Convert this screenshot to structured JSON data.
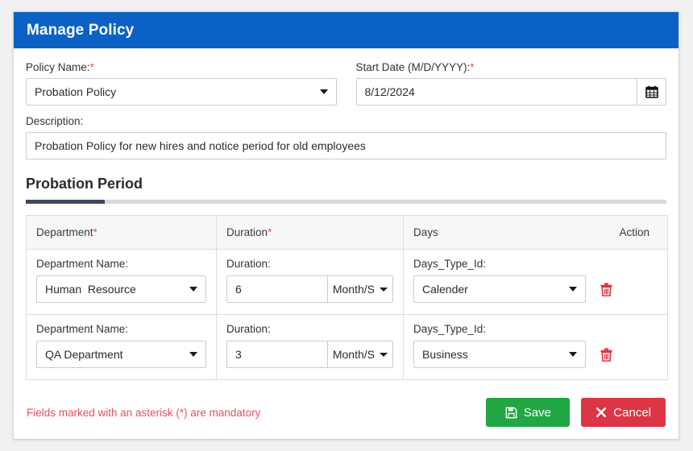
{
  "header": {
    "title": "Manage Policy",
    "bg_color": "#0b62c4"
  },
  "form": {
    "policy_name": {
      "label": "Policy Name:",
      "required_marker": "*",
      "value": "Probation Policy",
      "control": "select"
    },
    "start_date": {
      "label": "Start Date (M/D/YYYY):",
      "required_marker": "*",
      "value": "8/12/2024",
      "calendar_icon": "calendar-icon"
    },
    "description": {
      "label": "Description:",
      "value": "Probation Policy for new hires and notice period for old employees"
    }
  },
  "section": {
    "tab_label": "Probation Period",
    "active_underline_color": "#3d4a5c"
  },
  "table": {
    "columns": [
      {
        "label": "Department",
        "required_marker": "*"
      },
      {
        "label": "Duration",
        "required_marker": "*"
      },
      {
        "label": "Days",
        "required_marker": ""
      },
      {
        "label": "Action",
        "required_marker": ""
      }
    ],
    "field_labels": {
      "department": "Department Name:",
      "duration": "Duration:",
      "days_type": "Days_Type_Id:"
    },
    "rows": [
      {
        "department": "Human  Resource",
        "duration_value": "6",
        "duration_unit": "Month/S",
        "days_type": "Calender",
        "delete_icon": "trash-icon"
      },
      {
        "department": "QA Department",
        "duration_value": "3",
        "duration_unit": "Month/S",
        "days_type": "Business",
        "delete_icon": "trash-icon"
      }
    ]
  },
  "footer": {
    "mandatory_note": "Fields marked with an asterisk (*) are mandatory",
    "save_label": "Save",
    "save_icon": "save-floppy-icon",
    "save_color": "#21a744",
    "cancel_label": "Cancel",
    "cancel_icon": "close-x-icon",
    "cancel_color": "#dc3545",
    "required_color": "#e8505b"
  }
}
